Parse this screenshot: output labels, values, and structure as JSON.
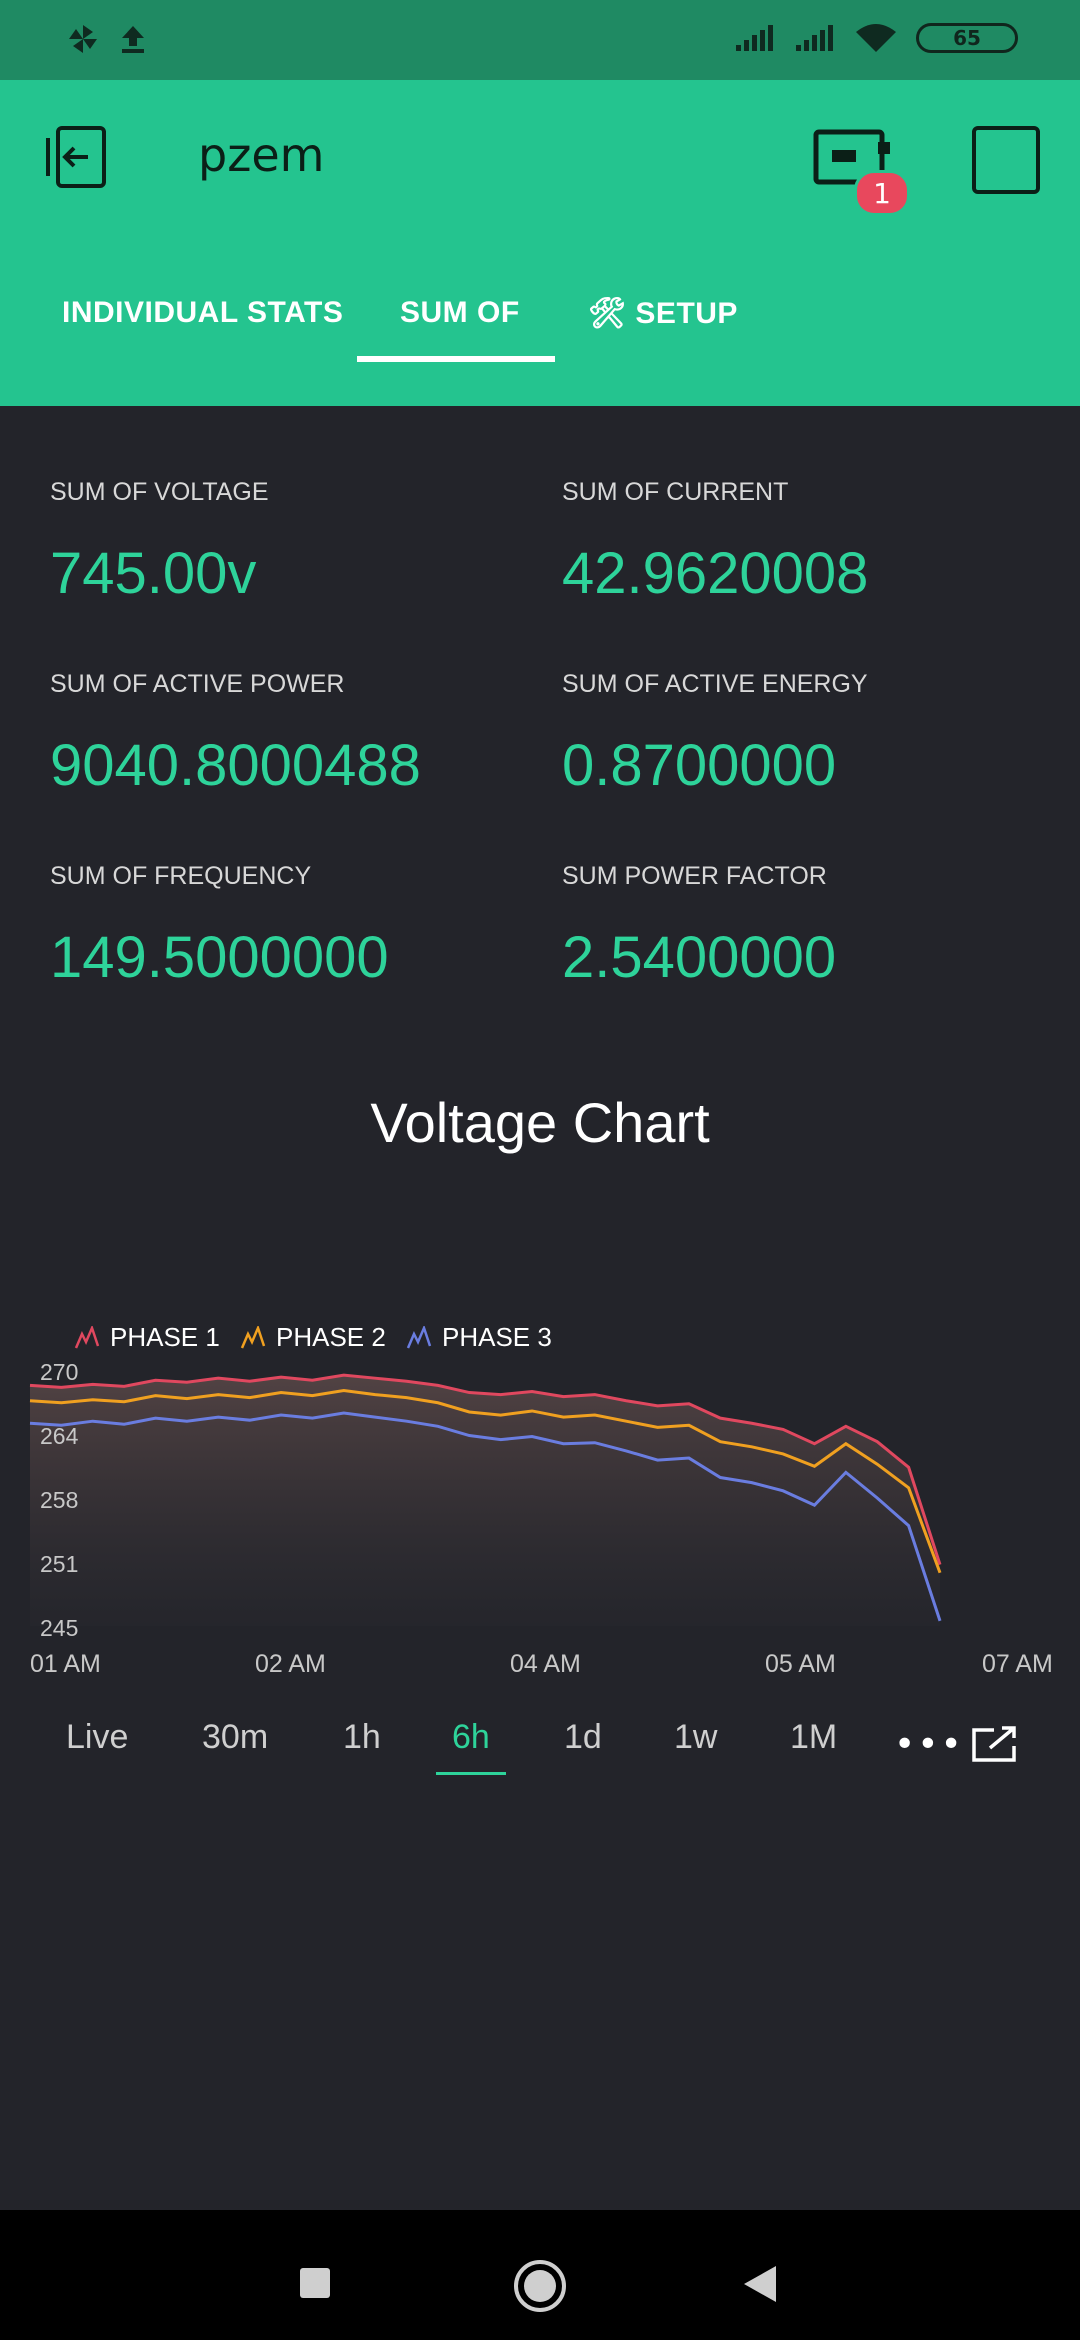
{
  "app": {
    "title": "pzem",
    "device_badge_count": "1"
  },
  "status_bar": {
    "battery": "65"
  },
  "tabs": [
    {
      "label": "INDIVIDUAL STATS"
    },
    {
      "label": "SUM OF"
    },
    {
      "label": "🛠 SETUP"
    }
  ],
  "active_tab": 1,
  "stats": [
    {
      "label": "SUM OF VOLTAGE",
      "value": "745.00v"
    },
    {
      "label": "SUM OF CURRENT",
      "value": "42.9620008"
    },
    {
      "label": "SUM OF ACTIVE POWER",
      "value": "9040.8000488"
    },
    {
      "label": "SUM OF ACTIVE ENERGY",
      "value": "0.8700000"
    },
    {
      "label": "SUM OF FREQUENCY",
      "value": "149.5000000"
    },
    {
      "label": "SUM POWER FACTOR",
      "value": "2.5400000"
    }
  ],
  "chart_data": {
    "type": "area",
    "title": "Voltage Chart",
    "x_ticks": [
      "01 AM",
      "02 AM",
      "04 AM",
      "05 AM",
      "07 AM"
    ],
    "y_ticks": [
      "270",
      "264",
      "258",
      "251",
      "245"
    ],
    "ylim": [
      245,
      270
    ],
    "legend_placement": "top-left",
    "series": [
      {
        "name": "PHASE 1",
        "color": "#e0485f",
        "values": [
          268.5,
          268.3,
          268.6,
          268.4,
          269.0,
          268.8,
          269.2,
          268.9,
          269.3,
          269.0,
          269.5,
          269.2,
          268.9,
          268.5,
          267.8,
          267.6,
          267.9,
          267.4,
          267.6,
          267.0,
          266.5,
          266.7,
          265.3,
          264.8,
          264.2,
          262.8,
          264.5,
          263.0,
          260.5,
          251.0
        ]
      },
      {
        "name": "PHASE 2",
        "color": "#f0a020",
        "values": [
          267.0,
          266.8,
          267.1,
          266.9,
          267.5,
          267.2,
          267.6,
          267.3,
          267.8,
          267.5,
          268.0,
          267.6,
          267.3,
          266.8,
          265.9,
          265.6,
          266.0,
          265.4,
          265.6,
          265.0,
          264.4,
          264.6,
          263.0,
          262.5,
          261.8,
          260.6,
          262.8,
          260.8,
          258.5,
          250.2
        ]
      },
      {
        "name": "PHASE 3",
        "color": "#6a7de0",
        "values": [
          264.8,
          264.6,
          265.0,
          264.7,
          265.3,
          265.0,
          265.4,
          265.1,
          265.6,
          265.3,
          265.8,
          265.4,
          265.0,
          264.5,
          263.6,
          263.2,
          263.5,
          262.8,
          262.9,
          262.1,
          261.2,
          261.4,
          259.5,
          259.0,
          258.2,
          256.8,
          260.0,
          257.5,
          254.8,
          245.5
        ]
      }
    ]
  },
  "ranges": [
    "Live",
    "30m",
    "1h",
    "6h",
    "1d",
    "1w",
    "1M"
  ],
  "active_range": 3,
  "icons": {
    "back": "exit-to-app-icon",
    "device": "device-chip-icon",
    "more": "more-dots-icon",
    "expand": "open-external-icon",
    "nav_recent": "recents-square-icon",
    "nav_home": "home-circle-icon",
    "nav_back": "back-triangle-icon"
  }
}
